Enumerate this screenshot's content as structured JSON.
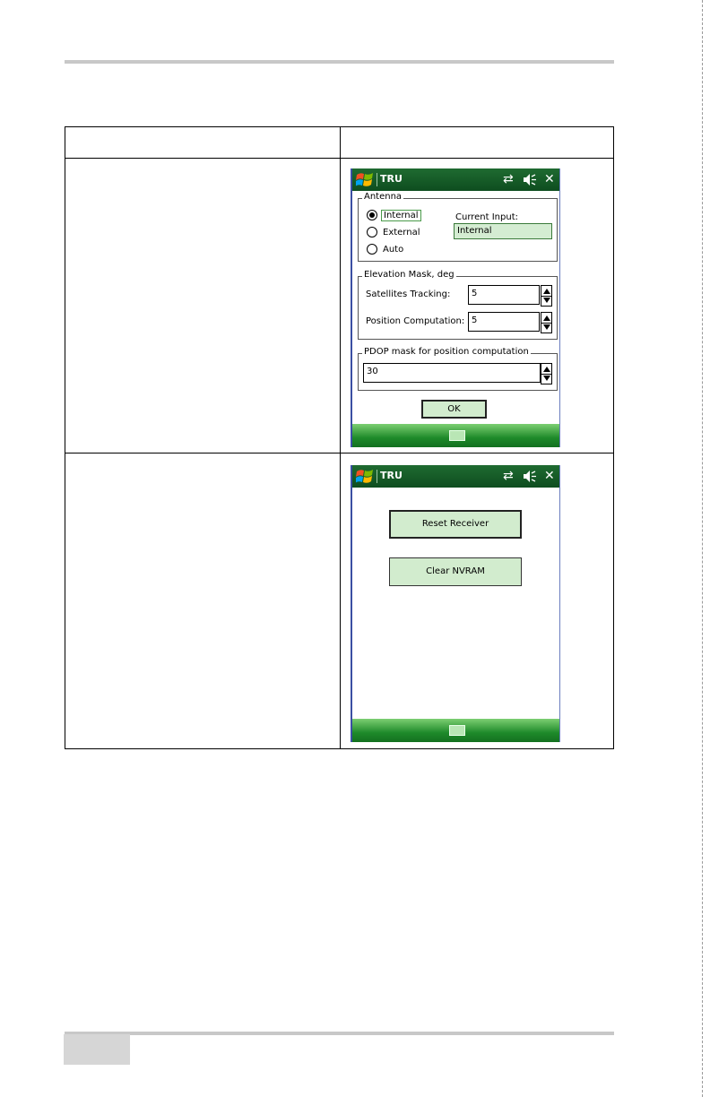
{
  "screen1": {
    "title": "TRU",
    "antenna": {
      "legend": "Antenna",
      "options": [
        "Internal",
        "External",
        "Auto"
      ],
      "selected": "Internal",
      "current_input_label": "Current Input:",
      "current_input_value": "Internal"
    },
    "elevation": {
      "legend": "Elevation Mask, deg",
      "satellites_label": "Satellites Tracking:",
      "satellites_value": "5",
      "position_label": "Position Computation:",
      "position_value": "5"
    },
    "pdop": {
      "legend": "PDOP mask for position computation",
      "value": "30"
    },
    "ok_label": "OK"
  },
  "screen2": {
    "title": "TRU",
    "reset_label": "Reset Receiver",
    "clear_label": "Clear NVRAM"
  },
  "colors": {
    "titlebar": "#0e4d1f",
    "button_fill": "#d2ecce",
    "bottombar": "#1e8a2a"
  }
}
